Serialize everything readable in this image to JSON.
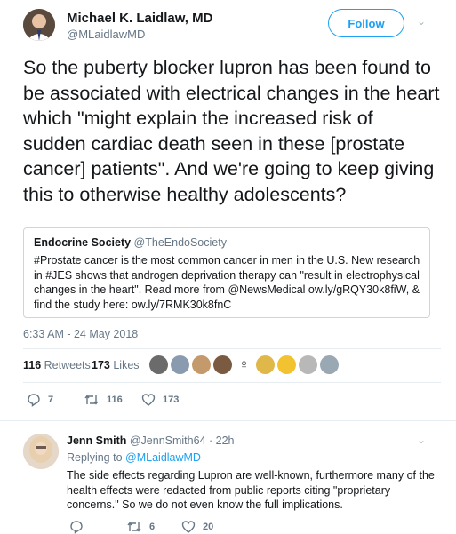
{
  "author": {
    "name": "Michael K. Laidlaw, MD",
    "handle": "@MLaidlawMD"
  },
  "follow_label": "Follow",
  "tweet_text": "So the puberty blocker lupron has been found to be associated with electrical changes in the heart which \"might explain the increased risk of sudden cardiac death seen in these [prostate cancer] patients\". And we're going to keep giving this to otherwise healthy adolescents?",
  "quoted": {
    "name": "Endocrine Society",
    "handle": "@TheEndoSociety",
    "text": "#Prostate cancer is the most common cancer in men in the U.S. New research in #JES shows that androgen deprivation therapy can \"result in electrophysical changes in the heart\". Read more from @NewsMedical ow.ly/gRQY30k8fiW, & find the study here: ow.ly/7RMK30k8fnC"
  },
  "timestamp": "6:33 AM - 24 May 2018",
  "stats": {
    "retweets_count": "116",
    "retweets_label": "Retweets",
    "likes_count": "173",
    "likes_label": "Likes"
  },
  "likers_avatar_colors": [
    "#6b6b6b",
    "#8a9bb0",
    "#c49a6c",
    "#7a5a40",
    "#3a3a3a",
    "#e0b84a",
    "#f2c230",
    "#b8b8b8",
    "#9aa8b4"
  ],
  "actions": {
    "replies": "7",
    "retweets": "116",
    "likes": "173"
  },
  "reply": {
    "name": "Jenn Smith",
    "handle": "@JennSmith64",
    "time": "· 22h",
    "replying_prefix": "Replying to",
    "replying_to": "@MLaidlawMD",
    "text": "The side effects regarding Lupron are well-known, furthermore many of the health effects were redacted from public reports citing \"proprietary concerns.\" So we do not even know the full implications.",
    "actions": {
      "retweets": "6",
      "likes": "20"
    }
  },
  "colors": {
    "accent": "#1da1f2",
    "muted": "#657786",
    "border": "#e6ecf0"
  }
}
